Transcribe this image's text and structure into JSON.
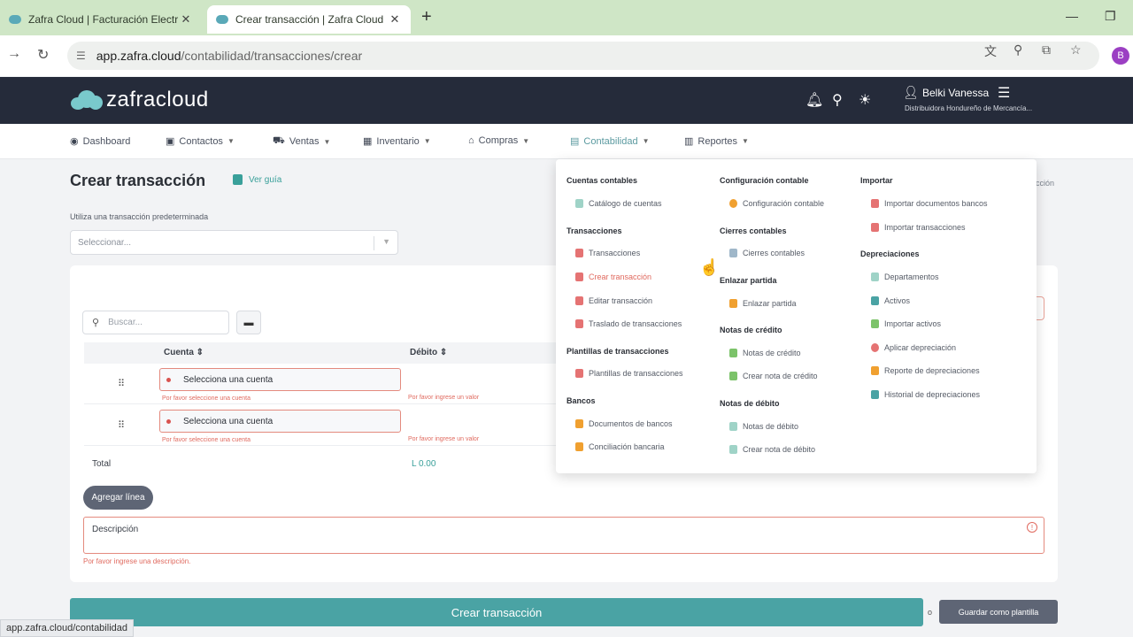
{
  "browser": {
    "tabs": [
      {
        "title": "Zafra Cloud | Facturación Electr",
        "active": false
      },
      {
        "title": "Crear transacción | Zafra Cloud",
        "active": true
      }
    ],
    "new_tab": "+",
    "close": "✕",
    "minimize": "—",
    "restore": "❐",
    "url_host": "app.zafra.cloud",
    "url_path": "/contabilidad/transacciones/crear",
    "profile_initial": "B",
    "status_url": "app.zafra.cloud/contabilidad"
  },
  "header": {
    "logo": "zafracloud",
    "user_name": "Belki Vanessa",
    "company": "Distribuidora Hondureño de Mercancía...",
    "icons": [
      "bell-icon",
      "search-icon",
      "sun-icon",
      "user-icon",
      "menu-icon"
    ]
  },
  "nav": {
    "items": [
      {
        "label": "Dashboard",
        "icon": "gauge-icon",
        "has_menu": false
      },
      {
        "label": "Contactos",
        "icon": "contacts-icon",
        "has_menu": true
      },
      {
        "label": "Ventas",
        "icon": "sales-icon",
        "has_menu": true
      },
      {
        "label": "Inventario",
        "icon": "inventory-icon",
        "has_menu": true
      },
      {
        "label": "Compras",
        "icon": "store-icon",
        "has_menu": true
      },
      {
        "label": "Contabilidad",
        "icon": "ledger-icon",
        "has_menu": true,
        "active": true
      },
      {
        "label": "Reportes",
        "icon": "chart-icon",
        "has_menu": true
      }
    ]
  },
  "page": {
    "title": "Crear transacción",
    "guide_label": "Ver guía",
    "crumb_fragment": "cción",
    "preset_label": "Utiliza una transacción predeterminada",
    "preset_placeholder": "Seleccionar...",
    "search_placeholder": "Buscar...",
    "table": {
      "headers": [
        "Cuenta",
        "Débito"
      ],
      "rows": [
        {
          "account": "Selecciona una cuenta",
          "account_error": "Por favor seleccione una cuenta",
          "debit_error": "Por favor ingrese un valor"
        },
        {
          "account": "Selecciona una cuenta",
          "account_error": "Por favor seleccione una cuenta",
          "debit_error": "Por favor ingrese un valor"
        }
      ],
      "total_label": "Total",
      "total_value": "L 0.00"
    },
    "add_line": "Agregar línea",
    "description_label": "Descripción",
    "description_error": "Por favor ingrese una descripción.",
    "create_button": "Crear transacción",
    "or": "o",
    "save_template": "Guardar como plantilla"
  },
  "mega_menu": {
    "col1": {
      "sections": [
        {
          "title": "Cuentas contables",
          "items": [
            {
              "label": "Catálogo de cuentas",
              "color": "#9fd3c7"
            }
          ]
        },
        {
          "title": "Transacciones",
          "items": [
            {
              "label": "Transacciones",
              "color": "#e57373"
            },
            {
              "label": "Crear transacción",
              "color": "#e57373",
              "hover": true
            },
            {
              "label": "Editar transacción",
              "color": "#e57373"
            },
            {
              "label": "Traslado de transacciones",
              "color": "#e57373"
            }
          ]
        },
        {
          "title": "Plantillas de transacciones",
          "items": [
            {
              "label": "Plantillas de transacciones",
              "color": "#e57373"
            }
          ]
        },
        {
          "title": "Bancos",
          "items": [
            {
              "label": "Documentos de bancos",
              "color": "#f0a030"
            },
            {
              "label": "Conciliación bancaria",
              "color": "#f0a030"
            }
          ]
        }
      ]
    },
    "col2": {
      "sections": [
        {
          "title": "Configuración contable",
          "items": [
            {
              "label": "Configuración contable",
              "color": "#f0a030"
            }
          ]
        },
        {
          "title": "Cierres contables",
          "items": [
            {
              "label": "Cierres contables",
              "color": "#9fb7c9"
            }
          ]
        },
        {
          "title": "Enlazar partida",
          "items": [
            {
              "label": "Enlazar partida",
              "color": "#f0a030"
            }
          ]
        },
        {
          "title": "Notas de crédito",
          "items": [
            {
              "label": "Notas de crédito",
              "color": "#7cc36a"
            },
            {
              "label": "Crear nota de crédito",
              "color": "#7cc36a"
            }
          ]
        },
        {
          "title": "Notas de débito",
          "items": [
            {
              "label": "Notas de débito",
              "color": "#9fd3c7"
            },
            {
              "label": "Crear nota de débito",
              "color": "#9fd3c7"
            }
          ]
        }
      ]
    },
    "col3": {
      "sections": [
        {
          "title": "Importar",
          "items": [
            {
              "label": "Importar documentos bancos",
              "color": "#e57373"
            },
            {
              "label": "Importar transacciones",
              "color": "#e57373"
            }
          ]
        },
        {
          "title": "Depreciaciones",
          "items": [
            {
              "label": "Departamentos",
              "color": "#9fd3c7"
            },
            {
              "label": "Activos",
              "color": "#4aa3a4"
            },
            {
              "label": "Importar activos",
              "color": "#7cc36a"
            },
            {
              "label": "Aplicar depreciación",
              "color": "#e57373"
            },
            {
              "label": "Reporte de depreciaciones",
              "color": "#f0a030"
            },
            {
              "label": "Historial de depreciaciones",
              "color": "#4aa3a4"
            }
          ]
        }
      ]
    }
  },
  "colors": {
    "accent": "#4aa3a4",
    "header_bg": "#252b3a",
    "error": "#e06a5f"
  }
}
